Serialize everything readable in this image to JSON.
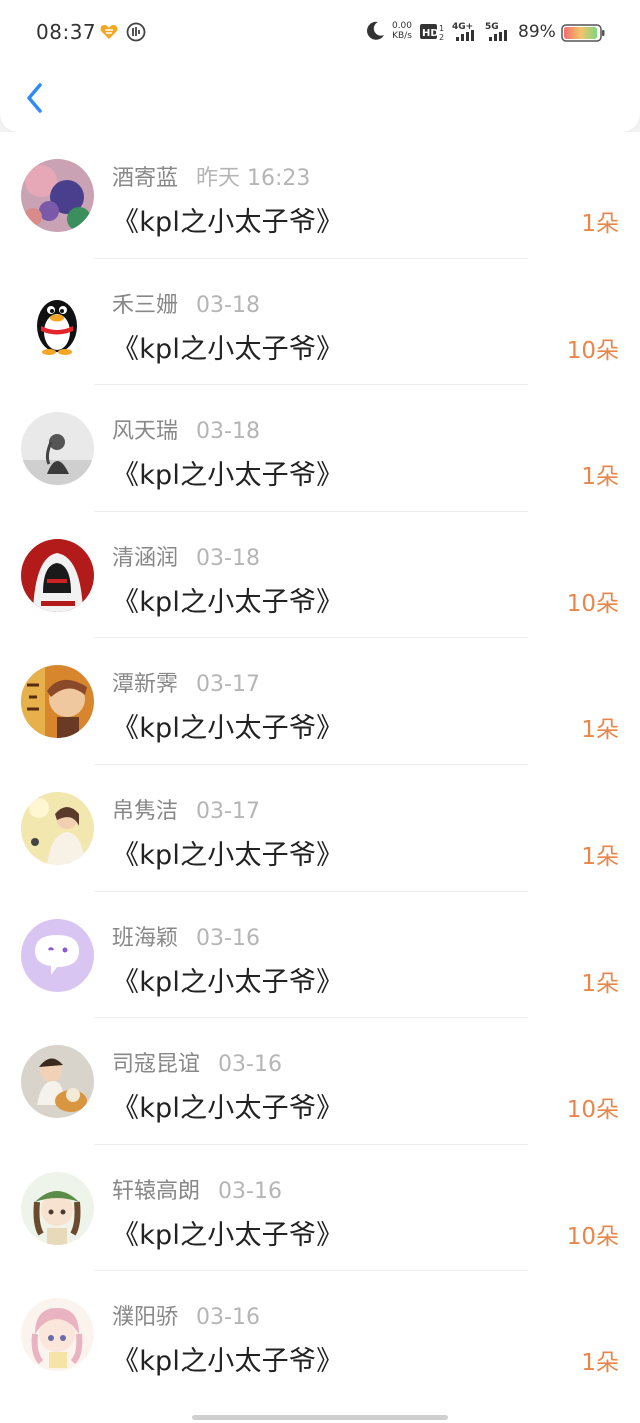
{
  "status_bar": {
    "time": "08:37",
    "net_speed_value": "0.00",
    "net_speed_unit": "KB/s",
    "battery_percent": "89%"
  },
  "colors": {
    "accent_blue": "#2f8cf6",
    "gift_count_orange": "#e8864b",
    "name_gray": "#888888",
    "date_gray": "#b5b5b5"
  },
  "gifts": [
    {
      "name": "酒寄蓝",
      "date": "昨天 16:23",
      "gift": "《kpl之小太子爷》",
      "count": "1朵",
      "avatar_icon": "balloons-avatar"
    },
    {
      "name": "禾三姗",
      "date": "03-18",
      "gift": "《kpl之小太子爷》",
      "count": "10朵",
      "avatar_icon": "qq-penguin-avatar"
    },
    {
      "name": "风天瑞",
      "date": "03-18",
      "gift": "《kpl之小太子爷》",
      "count": "1朵",
      "avatar_icon": "gray-photo-avatar"
    },
    {
      "name": "清涵润",
      "date": "03-18",
      "gift": "《kpl之小太子爷》",
      "count": "10朵",
      "avatar_icon": "red-hood-avatar"
    },
    {
      "name": "潭新霁",
      "date": "03-17",
      "gift": "《kpl之小太子爷》",
      "count": "1朵",
      "avatar_icon": "anime-orange-avatar"
    },
    {
      "name": "帛隽洁",
      "date": "03-17",
      "gift": "《kpl之小太子爷》",
      "count": "1朵",
      "avatar_icon": "girl-photo-avatar"
    },
    {
      "name": "班海颖",
      "date": "03-16",
      "gift": "《kpl之小太子爷》",
      "count": "1朵",
      "avatar_icon": "chat-bubble-avatar"
    },
    {
      "name": "司寇昆谊",
      "date": "03-16",
      "gift": "《kpl之小太子爷》",
      "count": "10朵",
      "avatar_icon": "kid-dog-avatar"
    },
    {
      "name": "轩辕高朗",
      "date": "03-16",
      "gift": "《kpl之小太子爷》",
      "count": "10朵",
      "avatar_icon": "anime-green-hat-avatar"
    },
    {
      "name": "濮阳骄",
      "date": "03-16",
      "gift": "《kpl之小太子爷》",
      "count": "1朵",
      "avatar_icon": "anime-pink-avatar"
    }
  ]
}
